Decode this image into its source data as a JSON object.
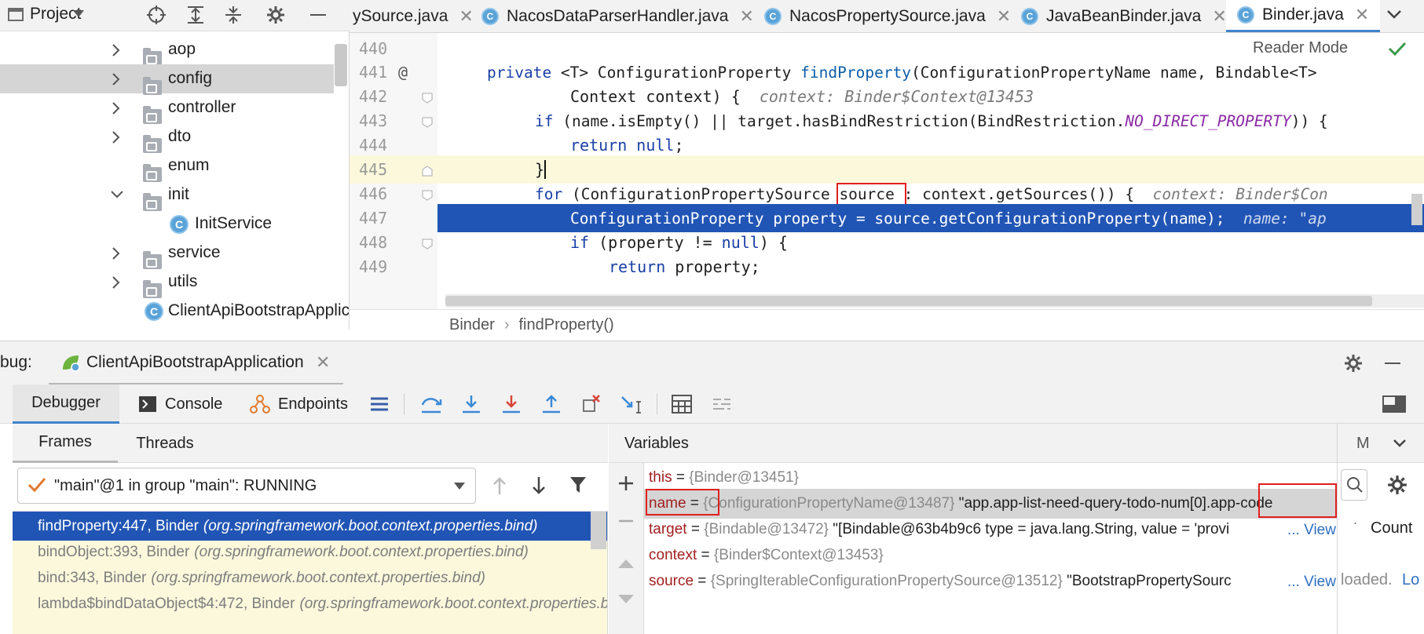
{
  "project": {
    "title": "Project",
    "tree": [
      {
        "label": "aop",
        "kind": "folder",
        "expand": "collapsed",
        "indent": 1
      },
      {
        "label": "config",
        "kind": "folder",
        "expand": "collapsed",
        "indent": 1,
        "selected": true
      },
      {
        "label": "controller",
        "kind": "folder",
        "expand": "collapsed",
        "indent": 1
      },
      {
        "label": "dto",
        "kind": "folder",
        "expand": "collapsed",
        "indent": 1
      },
      {
        "label": "enum",
        "kind": "folder",
        "expand": "none",
        "indent": 1
      },
      {
        "label": "init",
        "kind": "folder",
        "expand": "expanded",
        "indent": 1
      },
      {
        "label": "InitService",
        "kind": "class",
        "expand": "none",
        "indent": 2
      },
      {
        "label": "service",
        "kind": "folder",
        "expand": "collapsed",
        "indent": 1
      },
      {
        "label": "utils",
        "kind": "folder",
        "expand": "collapsed",
        "indent": 1
      },
      {
        "label": "ClientApiBootstrapApplic",
        "kind": "spring-class",
        "expand": "none",
        "indent": 1
      }
    ]
  },
  "tabs": [
    {
      "label": "ySource.java",
      "icon": false
    },
    {
      "label": "NacosDataParserHandler.java",
      "icon": true
    },
    {
      "label": "NacosPropertySource.java",
      "icon": true
    },
    {
      "label": "JavaBeanBinder.java",
      "icon": true
    },
    {
      "label": "Binder.java",
      "icon": true,
      "active": true
    }
  ],
  "editor": {
    "reader_mode": "Reader Mode",
    "lines": [
      {
        "num": "440",
        "marker": ""
      },
      {
        "num": "441",
        "marker": "@"
      },
      {
        "num": "442",
        "marker": ""
      },
      {
        "num": "443",
        "marker": ""
      },
      {
        "num": "444",
        "marker": ""
      },
      {
        "num": "445",
        "marker": ""
      },
      {
        "num": "446",
        "marker": ""
      },
      {
        "num": "447",
        "marker": ""
      },
      {
        "num": "448",
        "marker": ""
      },
      {
        "num": "449",
        "marker": ""
      }
    ],
    "code": {
      "l441_kw": "private",
      "l441_a": " <T> ConfigurationProperty ",
      "l441_fn": "findProperty",
      "l441_b": "(ConfigurationPropertyName name, Bindable<T>",
      "l442_a": "Context context) {",
      "l442_hint": "context: Binder$Context@13453",
      "l443_kw": "if",
      "l443_a": " (name.isEmpty() || target.hasBindRestriction(BindRestriction.",
      "l443_const": "NO_DIRECT_PROPERTY",
      "l443_b": ")) {",
      "l444_kw": "return",
      "l444_kw2": "null",
      "l444_a": ";",
      "l445_a": "}",
      "l446_kw": "for",
      "l446_a": " (ConfigurationPropertySource ",
      "l446_boxed": "source ",
      "l446_b": ": context.getSources()) {",
      "l446_hint": "context: Binder$Con",
      "l447_a": "ConfigurationProperty property = source.getConfigurationProperty(name);",
      "l447_hint": "name: \"ap",
      "l448_kw": "if",
      "l448_a": " (property != ",
      "l448_kw2": "null",
      "l448_b": ") {",
      "l449_kw": "return",
      "l449_a": " property;"
    }
  },
  "breadcrumb": {
    "class": "Binder",
    "method": "findProperty()"
  },
  "debug": {
    "label": "bug:",
    "session": "ClientApiBootstrapApplication",
    "tabs": {
      "debugger": "Debugger",
      "console": "Console",
      "endpoints": "Endpoints"
    },
    "frames_tab": "Frames",
    "threads_tab": "Threads",
    "thread_select": "\"main\"@1 in group \"main\": RUNNING",
    "frames": [
      {
        "method": "findProperty:447, Binder",
        "pkg": "(org.springframework.boot.context.properties.bind)",
        "selected": true
      },
      {
        "method": "bindObject:393, Binder",
        "pkg": "(org.springframework.boot.context.properties.bind)"
      },
      {
        "method": "bind:343, Binder",
        "pkg": "(org.springframework.boot.context.properties.bind)"
      },
      {
        "method": "lambda$bindDataObject$4:472, Binder",
        "pkg": "(org.springframework.boot.context.properties.bind)"
      }
    ],
    "variables_title": "Variables",
    "variables": [
      {
        "name": "this",
        "type": "{Binder@13451}",
        "value": "",
        "link": ""
      },
      {
        "name": "name",
        "type": "{ConfigurationPropertyName@13487}",
        "value": "\"app.app-list-need-query-todo-num[0].app-code",
        "link": "",
        "selected": true
      },
      {
        "name": "target",
        "type": "{Bindable@13472}",
        "value": "\"[Bindable@63b4b9c6 type = java.lang.String, value = 'provi",
        "link": "... View"
      },
      {
        "name": "context",
        "type": "{Binder$Context@13453}",
        "value": "",
        "link": ""
      },
      {
        "name": "source",
        "type": "{SpringIterableConfigurationPropertySource@13512}",
        "value": "\"BootstrapPropertySourc",
        "link": "... View"
      }
    ],
    "right_panel": {
      "tab": "M",
      "count": "Count",
      "loaded": "loaded.",
      "link": "Lo"
    }
  },
  "colors": {
    "accent": "#2155b5",
    "highlight_box": "#e01f1f",
    "keyword": "#1a3fa6",
    "constant": "#8a2aa6"
  }
}
